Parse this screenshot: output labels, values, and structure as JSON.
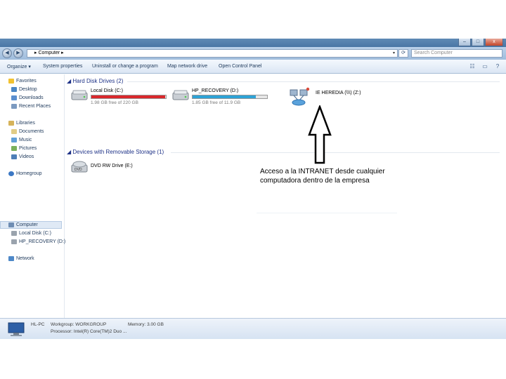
{
  "window": {
    "controls": {
      "minimize": "–",
      "maximize": "□",
      "close": "x"
    }
  },
  "address": {
    "back": "◀",
    "forward": "▶",
    "path": "▸ Computer ▸",
    "refresh": "⟳",
    "search_placeholder": "Search Computer"
  },
  "toolbar": {
    "organize": "Organize ▾",
    "system_properties": "System properties",
    "uninstall": "Uninstall or change a program",
    "map_drive": "Map network drive",
    "control_panel": "Open Control Panel"
  },
  "sidebar": {
    "favorites": "Favorites",
    "desktop": "Desktop",
    "downloads": "Downloads",
    "recent_places": "Recent Places",
    "libraries": "Libraries",
    "documents": "Documents",
    "music": "Music",
    "pictures": "Pictures",
    "videos": "Videos",
    "homegroup": "Homegroup",
    "computer": "Computer",
    "local_disk": "Local Disk (C:)",
    "hp_recovery": "HP_RECOVERY (D:)",
    "network": "Network"
  },
  "content": {
    "hard_disk_header": "Hard Disk Drives (2)",
    "removable_header": "Devices with Removable Storage (1)",
    "drive_c": {
      "name": "Local Disk (C:)",
      "free": "1.98 GB free of 220 GB",
      "used_fraction": 0.99,
      "bar_color": "#d9282c"
    },
    "drive_d": {
      "name": "HP_RECOVERY (D:)",
      "free": "1.85 GB free of 11.9 GB",
      "used_fraction": 0.85,
      "bar_color": "#2da3d6"
    },
    "network_drive": {
      "name": "IE HEREDIA (\\\\\\) (Z:)"
    },
    "dvd": {
      "name": "DVD RW Drive (E:)"
    }
  },
  "status": {
    "pc": "HL-PC",
    "workgroup": "Workgroup: WORKGROUP",
    "memory": "Memory: 3.00 GB",
    "processor": "Processor: Intel(R) Core(TM)2 Duo ..."
  },
  "annotation": {
    "line1": "Acceso a la INTRANET desde cualquier",
    "line2": "computadora dentro de la empresa"
  }
}
